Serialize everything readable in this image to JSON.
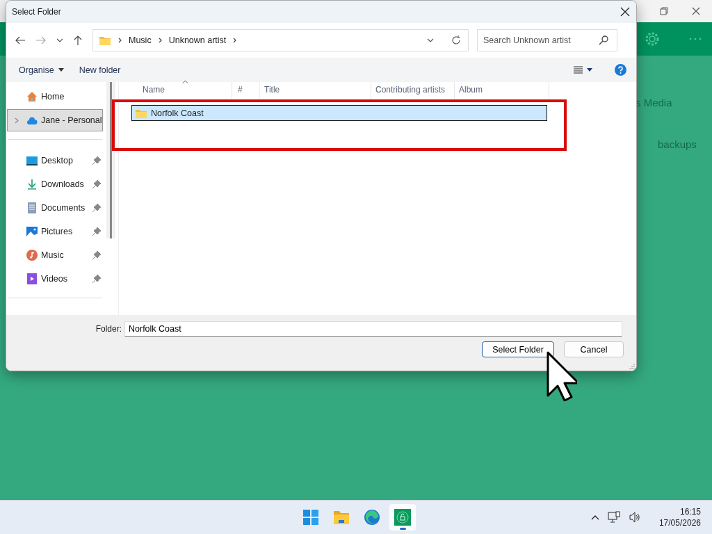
{
  "background_app": {
    "texts": [
      "s Media",
      "backups"
    ]
  },
  "dialog": {
    "title": "Select Folder",
    "address": {
      "segments": [
        "Music",
        "Unknown artist"
      ]
    },
    "search": {
      "placeholder": "Search Unknown artist"
    },
    "toolbar": {
      "organise": "Organise",
      "new_folder": "New folder"
    },
    "sidebar": {
      "groups": [
        [
          {
            "label": "Home",
            "kind": "home",
            "selected": false,
            "pinned": false,
            "expandable": false
          },
          {
            "label": "Jane - Personal",
            "kind": "cloud",
            "selected": true,
            "pinned": false,
            "expandable": true
          }
        ],
        [
          {
            "label": "Desktop",
            "kind": "desktop",
            "selected": false,
            "pinned": true,
            "expandable": false
          },
          {
            "label": "Downloads",
            "kind": "downloads",
            "selected": false,
            "pinned": true,
            "expandable": false
          },
          {
            "label": "Documents",
            "kind": "documents",
            "selected": false,
            "pinned": true,
            "expandable": false
          },
          {
            "label": "Pictures",
            "kind": "pictures",
            "selected": false,
            "pinned": true,
            "expandable": false
          },
          {
            "label": "Music",
            "kind": "music",
            "selected": false,
            "pinned": true,
            "expandable": false
          },
          {
            "label": "Videos",
            "kind": "videos",
            "selected": false,
            "pinned": true,
            "expandable": false
          }
        ]
      ]
    },
    "columns": [
      {
        "label": "Name",
        "sorted": true
      },
      {
        "label": "#",
        "sorted": false
      },
      {
        "label": "Title",
        "sorted": false
      },
      {
        "label": "Contributing artists",
        "sorted": false
      },
      {
        "label": "Album",
        "sorted": false
      }
    ],
    "rows": [
      {
        "name": "Norfolk Coast",
        "selected": true
      }
    ],
    "folder_field": {
      "label": "Folder:",
      "value": "Norfolk Coast"
    },
    "buttons": [
      {
        "label": "Select Folder",
        "default": true
      },
      {
        "label": "Cancel",
        "default": false
      }
    ]
  },
  "taskbar": {
    "apps": [
      {
        "kind": "start",
        "active": false
      },
      {
        "kind": "explorer",
        "active": false
      },
      {
        "kind": "edge",
        "active": false
      },
      {
        "kind": "app",
        "active": true
      }
    ],
    "time": "16:15",
    "date": "17/05/2026"
  }
}
